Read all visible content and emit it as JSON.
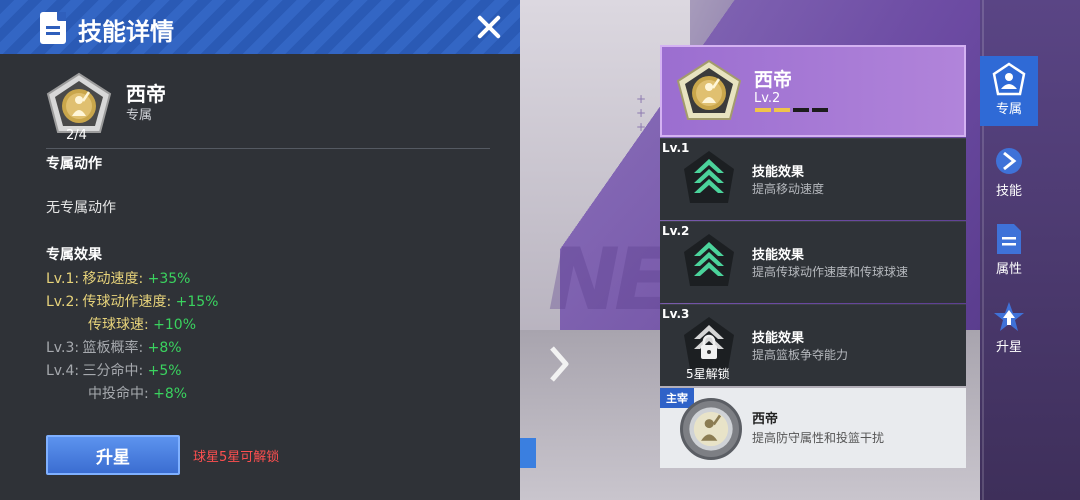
{
  "detail": {
    "title": "技能详情",
    "skill": {
      "name": "西帝",
      "type": "专属",
      "stars": "2/4"
    },
    "section_action": {
      "title": "专属动作",
      "body": "无专属动作"
    },
    "section_effect": {
      "title": "专属效果",
      "lines": [
        {
          "level": "Lv.1:",
          "text": "移动速度:",
          "value": "+35%"
        },
        {
          "level": "Lv.2:",
          "text": "传球动作速度:",
          "value": "+15%"
        },
        {
          "level": "",
          "text": "传球球速:",
          "value": "+10%"
        },
        {
          "level": "Lv.3:",
          "text": "篮板概率:",
          "value": "+8%"
        },
        {
          "level": "Lv.4:",
          "text": "三分命中:",
          "value": "+5%"
        },
        {
          "level": "",
          "text": "中投命中:",
          "value": "+8%"
        }
      ]
    },
    "upgrade_label": "升星",
    "unlock_hint": "球星5星可解锁"
  },
  "card": {
    "name": "西帝",
    "level": "Lv.2",
    "level_filled": 2,
    "level_total": 4
  },
  "levels": [
    {
      "tag": "Lv.1",
      "title": "技能效果",
      "desc": "提高移动速度",
      "icon": "arrow-up-icon",
      "locked": false
    },
    {
      "tag": "Lv.2",
      "title": "技能效果",
      "desc": "提高传球动作速度和传球球速",
      "icon": "arrow-up-icon",
      "locked": false
    },
    {
      "tag": "Lv.3",
      "title": "技能效果",
      "desc": "提高篮板争夺能力",
      "icon": "lock-icon",
      "locked": true,
      "lock_label": "5星解锁"
    }
  ],
  "master": {
    "tag": "主宰",
    "name": "西帝",
    "desc": "提高防守属性和投篮干扰"
  },
  "nav": [
    {
      "label": "专属",
      "icon": "player-icon",
      "active": true
    },
    {
      "label": "技能",
      "icon": "skill-icon",
      "active": false
    },
    {
      "label": "属性",
      "icon": "document-icon",
      "active": false
    },
    {
      "label": "升星",
      "icon": "star-up-icon",
      "active": false
    }
  ],
  "colors": {
    "accent": "#2f6ad6",
    "effect_active": "#e6d27a",
    "effect_value": "#3ad35f",
    "hint": "#ff4f4f"
  }
}
